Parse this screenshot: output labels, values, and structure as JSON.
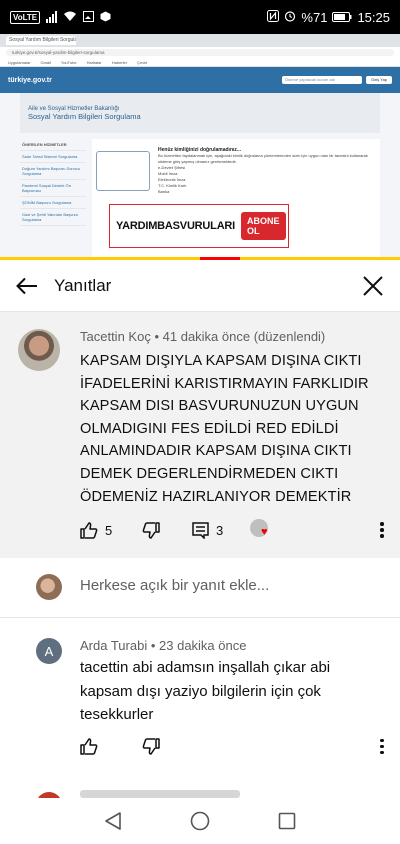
{
  "status_bar": {
    "volte": "VoLTE",
    "battery": "%71",
    "time": "15:25"
  },
  "video": {
    "browser_tab": "Sosyal Yardım Bilgileri Sorgulama",
    "url": "turkiye.gov.tr/sosyal-yardim-bilgileri-sorgulama",
    "bookmarks": [
      "Uygulamalar",
      "Gmail",
      "YouTube",
      "Haritalar",
      "Haberler",
      "Çeviri"
    ],
    "site_logo": "türkiye.gov.tr",
    "site_search": "Ödeme yapılacak kurum adı",
    "site_login": "Giriş Yap",
    "page_kicker": "Aile ve Sosyal Hizmetler Bakanlığı",
    "page_title": "Sosyal Yardım Bilgileri Sorgulama",
    "sidebar_heading": "ÖNERİLEN HİZMETLER",
    "sidebar_items": [
      "Sade Tahsil Sistemi Sorgulama",
      "Doğum Yardımı Başvuru Sonucu Sorgulama",
      "Pandemi Sosyal Destek Ön Başvurusu",
      "ŞÖNİM Başvuru Sorgulama",
      "Gazi ve Şehit Yakınları Başvuru Sorgulama"
    ],
    "notice_title": "Henüz kimliğinizi doğrulamadınız...",
    "notice_text": "Bu hizmetten faydalanmak için, aşağıdaki kimlik doğrulama yöntemlerinden sizin için uygun olan bir tanesini kullanarak sisteme giriş yapmış olmanız gerekmektedir.",
    "auth_methods": [
      "e-Devlet Şifresi",
      "Mobil İmza",
      "Elektronik İmza",
      "T.C. Kimlik Kartı",
      "Banka"
    ],
    "banner_text": "YARDIMBASVURULARI",
    "banner_button": "ABONE OL"
  },
  "replies_header": {
    "title": "Yanıtlar"
  },
  "main_comment": {
    "author": "Tacettin Koç",
    "time": "41 dakika önce",
    "edited": "(düzenlendi)",
    "text": "KAPSAM DIŞIYLA KAPSAM DIŞINA CIKTI İFADELERİNİ  KARISTIRMAYIN FARKLIDIR KAPSAM DISI BASVURUNUZUN UYGUN OLMADIGINI FES EDİLDİ RED EDİLDİ ANLAMINDADIR KAPSAM DIŞINA CIKTI DEMEK DEGERLENDİRMEDEN CIKTI ÖDEMENİZ HAZIRLANIYOR DEMEKTİR",
    "likes": "5",
    "replies": "3"
  },
  "reply_input": {
    "placeholder": "Herkese açık bir yanıt ekle..."
  },
  "reply": {
    "avatar_letter": "A",
    "author": "Arda Turabi",
    "time": "23 dakika önce",
    "text": "tacettin abi adamsın inşallah çıkar abi kapsam dışı yaziyo bilgilerin için çok tesekkurler"
  },
  "colors": {
    "accent_red": "#d9272e",
    "site_blue": "#2e6fa6",
    "progress_yellow": "#ffcc00"
  },
  "icons": {
    "back": "arrow-left-icon",
    "close": "close-icon",
    "like": "thumb-up-icon",
    "dislike": "thumb-down-icon",
    "reply": "comment-icon",
    "more": "more-vert-icon",
    "nav_back": "triangle-back-icon",
    "nav_home": "circle-home-icon",
    "nav_recent": "square-recent-icon"
  }
}
